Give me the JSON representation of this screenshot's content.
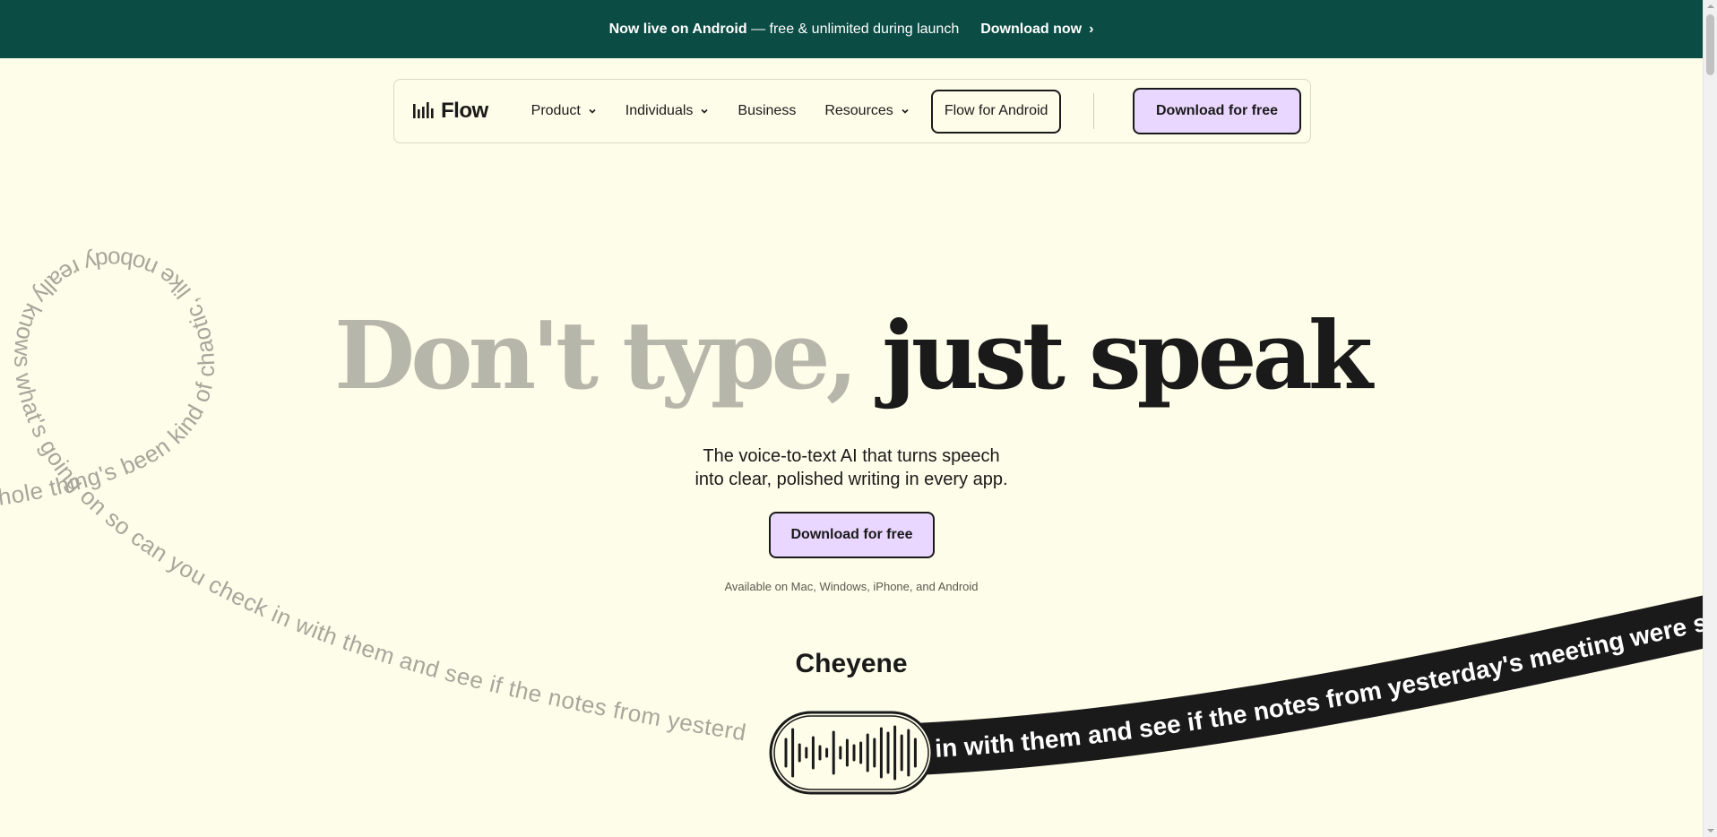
{
  "banner": {
    "strong_text": "Now live on Android",
    "rest_text": " — free & unlimited during launch",
    "link_label": "Download now",
    "link_arrow": "›"
  },
  "nav": {
    "logo_text": "Flow",
    "items": [
      {
        "label": "Product",
        "has_dropdown": true
      },
      {
        "label": "Individuals",
        "has_dropdown": true
      },
      {
        "label": "Business",
        "has_dropdown": false
      },
      {
        "label": "Resources",
        "has_dropdown": true
      }
    ],
    "android_button": "Flow for Android",
    "cta": "Download for free"
  },
  "hero": {
    "headline_muted": "Don't type,",
    "headline_dark": "just speak",
    "subhead_line1": "The voice-to-text AI that turns speech",
    "subhead_line2": "into clear, polished writing in every app.",
    "cta": "Download for free",
    "availability": "Available on Mac, Windows, iPhone, and Android"
  },
  "demo": {
    "loop_text": "whole thing's been kind of chaotic, like nobody really knows what's going on so can you check in with them and see if the notes from yesterd",
    "ribbon_text": "k in with them and see if the notes from yesterday's meeting were sen",
    "speaker_name": "Cheyene"
  },
  "colors": {
    "background": "#fefde9",
    "banner": "#0b4c44",
    "cta": "#ead7ff",
    "text": "#1a1a1a",
    "muted_text": "#b7b6aa"
  },
  "icons": {
    "logo": "waveform-bars-icon",
    "dropdown": "chevron-down-icon",
    "banner_link": "chevron-right-icon",
    "voice": "audio-waveform-icon"
  }
}
